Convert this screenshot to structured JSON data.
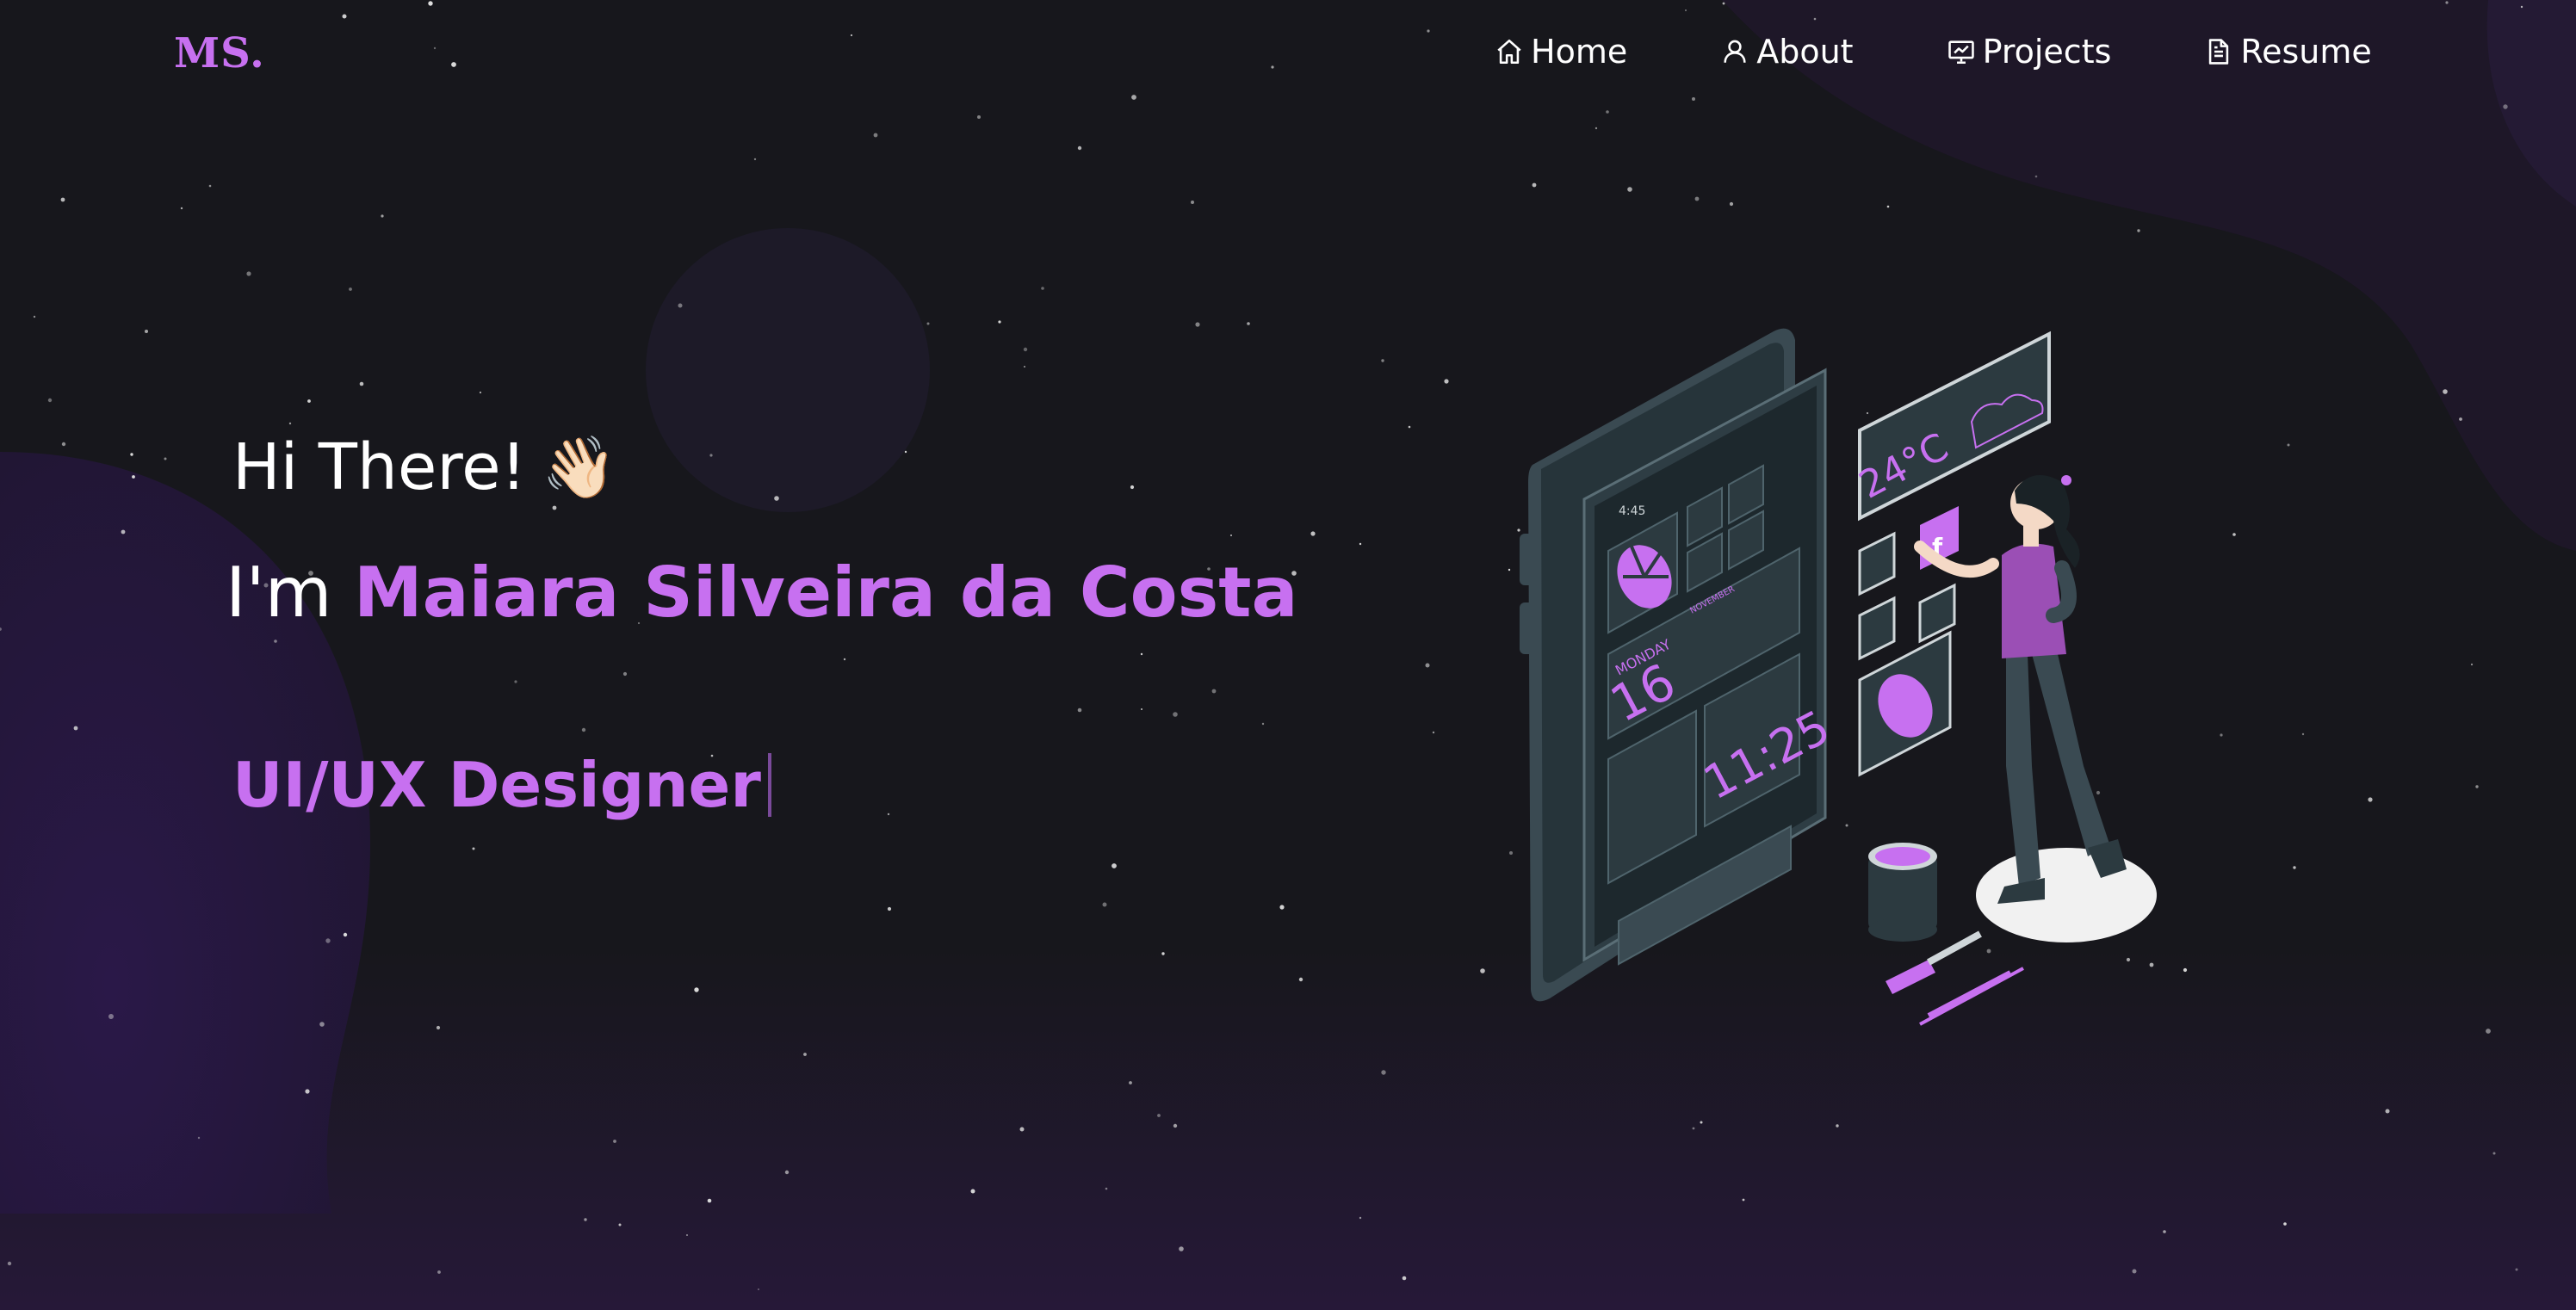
{
  "logo": "MS.",
  "nav": {
    "items": [
      {
        "label": "Home",
        "icon": "home-icon"
      },
      {
        "label": "About",
        "icon": "user-icon"
      },
      {
        "label": "Projects",
        "icon": "presentation-icon"
      },
      {
        "label": "Resume",
        "icon": "document-icon"
      }
    ]
  },
  "hero": {
    "greeting": "Hi There!",
    "wave_emoji": "👋🏻",
    "intro_prefix": "I'm",
    "name": "Maiara Silveira da Costa",
    "role": "UI/UX Designer"
  },
  "illustration": {
    "phone_time": "4:45",
    "calendar_day": "MONDAY",
    "calendar_date": "16",
    "calendar_month": "NOVEMBER",
    "clock": "11:25",
    "weather_temp": "24°C"
  },
  "colors": {
    "accent": "#c770f0",
    "background": "#17171c",
    "blob": "#2a1a45"
  }
}
